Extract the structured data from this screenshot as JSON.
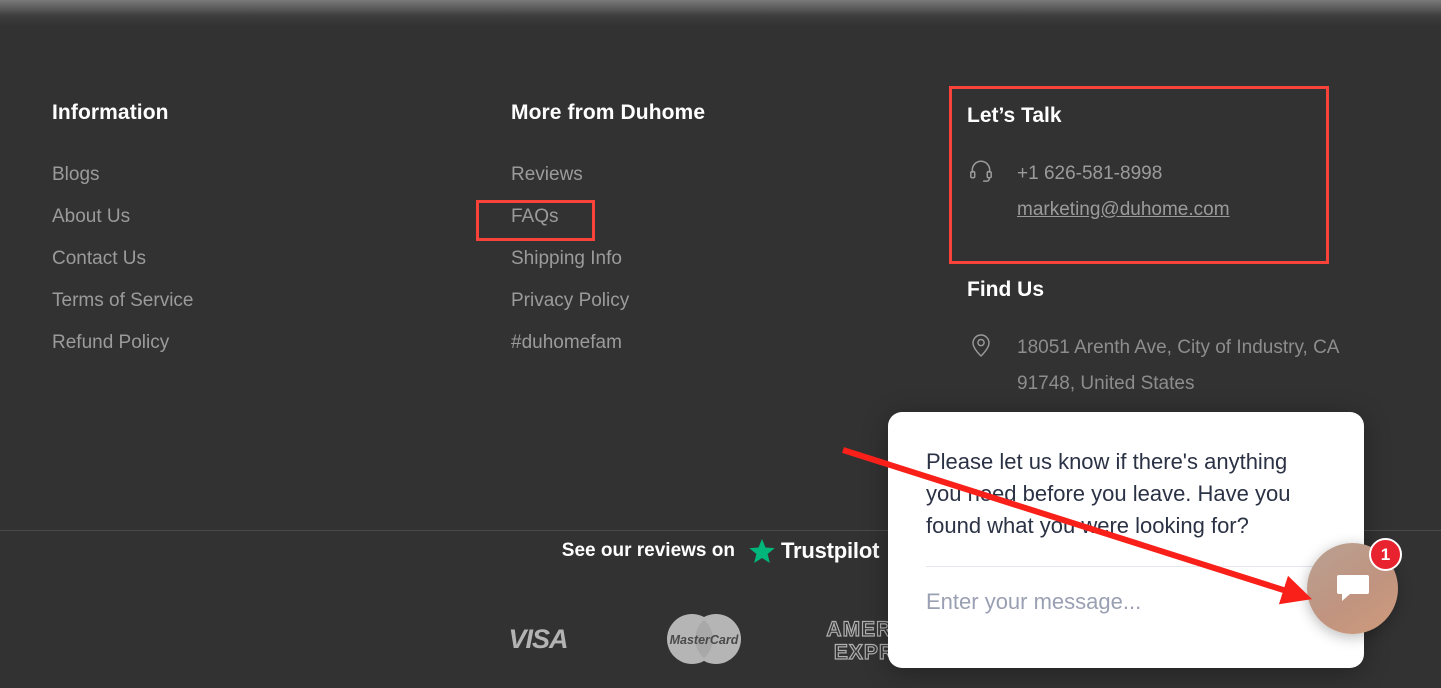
{
  "footer": {
    "columns": [
      {
        "heading": "Information",
        "links": [
          "Blogs",
          "About Us",
          "Contact Us",
          "Terms of Service",
          "Refund Policy"
        ]
      },
      {
        "heading": "More from Duhome",
        "links": [
          "Reviews",
          "FAQs",
          "Shipping Info",
          "Privacy Policy",
          "#duhomefam"
        ]
      }
    ],
    "contact": {
      "lets_talk_heading": "Let’s Talk",
      "phone": "+1 626-581-8998",
      "email": "marketing@duhome.com",
      "phone_icon": "headset-icon",
      "find_us_heading": "Find Us",
      "address": "18051 Arenth Ave, City of Industry, CA 91748, United States",
      "address_icon": "map-pin-icon"
    },
    "trustpilot": {
      "prefix": "See our reviews on",
      "brand": "Trustpilot",
      "star_icon": "trustpilot-star-icon",
      "star_color": "#00b67a"
    },
    "payments": [
      {
        "name": "visa-logo",
        "label": "VISA"
      },
      {
        "name": "mastercard-logo",
        "label": "MasterCard"
      },
      {
        "name": "amex-logo",
        "label": "AMERICAN EXPRESS"
      }
    ]
  },
  "chat_widget": {
    "message": "Please let us know if there's anything you need before you leave. Have you found what you were looking for?",
    "input_placeholder": "Enter your message...",
    "input_value": "",
    "badge_count": "1",
    "bubble_icon": "chat-bubble-icon"
  },
  "annotations": {
    "highlight_boxes": [
      {
        "name": "faqs-highlight",
        "color": "#f9423a"
      },
      {
        "name": "lets-talk-highlight",
        "color": "#f9423a"
      }
    ],
    "arrow": {
      "name": "pointer-arrow",
      "color": "#f9201a"
    }
  },
  "colors": {
    "background": "#323232",
    "heading_text": "#ffffff",
    "link_text": "#9b9b9b",
    "accent_red": "#f9423a",
    "trustpilot_green": "#00b67a",
    "chat_panel_bg": "#ffffff",
    "chat_text": "#2b3245",
    "badge_red": "#e8222e"
  }
}
